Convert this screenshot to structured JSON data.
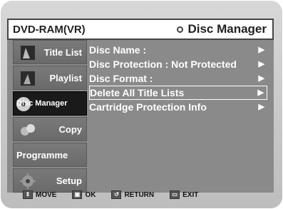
{
  "header": {
    "device": "DVD-RAM(VR)",
    "title": "Disc Manager"
  },
  "sidebar": {
    "items": [
      {
        "label": "Title List",
        "icon": "title-list-thumbnail"
      },
      {
        "label": "Playlist",
        "icon": "playlist-thumbnail"
      },
      {
        "label": "Disc Manager",
        "icon": "disc-icon",
        "active": true
      },
      {
        "label": "Copy",
        "icon": "copy-thumbnail"
      },
      {
        "label": "Programme",
        "icon": ""
      },
      {
        "label": "Setup",
        "icon": "gear-icon"
      }
    ]
  },
  "menu": {
    "items": [
      {
        "label": "Disc Name   :"
      },
      {
        "label": "Disc Protection : Not Protected"
      },
      {
        "label": "Disc Format  :"
      },
      {
        "label": "Delete All Title Lists",
        "selected": true
      },
      {
        "label": "Cartridge Protection Info"
      }
    ],
    "arrow": "▶"
  },
  "footer": {
    "move": "MOVE",
    "ok": "OK",
    "return": "RETURN",
    "exit": "EXIT"
  }
}
